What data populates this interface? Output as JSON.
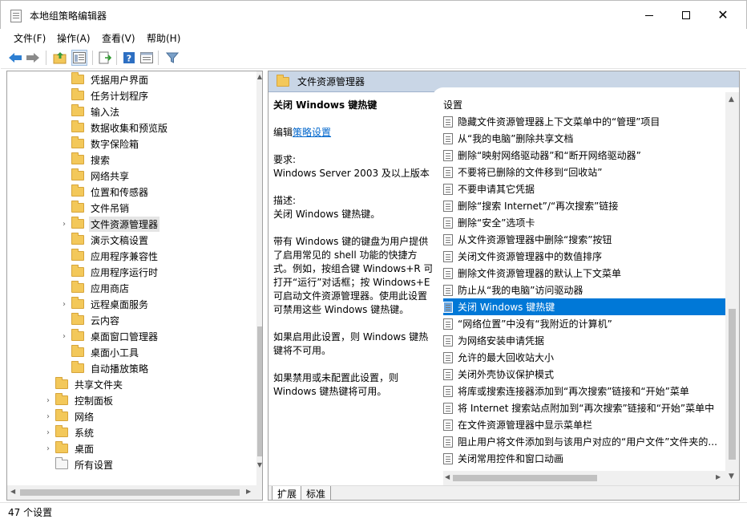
{
  "window": {
    "title": "本地组策略编辑器",
    "minimize": "—",
    "maximize": "□",
    "close": "✕"
  },
  "menu": {
    "items": [
      "文件(F)",
      "操作(A)",
      "查看(V)",
      "帮助(H)"
    ]
  },
  "toolbar": {
    "icons": [
      "back-arrow-icon",
      "forward-arrow-icon",
      "up-folder-icon",
      "show-hide-tree-icon",
      "export-list-icon",
      "help-icon",
      "properties-icon",
      "filter-icon"
    ]
  },
  "tree": {
    "items": [
      {
        "label": "凭据用户界面",
        "expandable": false,
        "indent": 2
      },
      {
        "label": "任务计划程序",
        "expandable": false,
        "indent": 2
      },
      {
        "label": "输入法",
        "expandable": false,
        "indent": 2
      },
      {
        "label": "数据收集和预览版",
        "expandable": false,
        "indent": 2
      },
      {
        "label": "数字保险箱",
        "expandable": false,
        "indent": 2
      },
      {
        "label": "搜索",
        "expandable": false,
        "indent": 2
      },
      {
        "label": "网络共享",
        "expandable": false,
        "indent": 2
      },
      {
        "label": "位置和传感器",
        "expandable": false,
        "indent": 2
      },
      {
        "label": "文件吊销",
        "expandable": false,
        "indent": 2
      },
      {
        "label": "文件资源管理器",
        "expandable": true,
        "indent": 2,
        "selected": true
      },
      {
        "label": "演示文稿设置",
        "expandable": false,
        "indent": 2
      },
      {
        "label": "应用程序兼容性",
        "expandable": false,
        "indent": 2
      },
      {
        "label": "应用程序运行时",
        "expandable": false,
        "indent": 2
      },
      {
        "label": "应用商店",
        "expandable": false,
        "indent": 2
      },
      {
        "label": "远程桌面服务",
        "expandable": true,
        "indent": 2
      },
      {
        "label": "云内容",
        "expandable": false,
        "indent": 2
      },
      {
        "label": "桌面窗口管理器",
        "expandable": true,
        "indent": 2
      },
      {
        "label": "桌面小工具",
        "expandable": false,
        "indent": 2
      },
      {
        "label": "自动播放策略",
        "expandable": false,
        "indent": 2
      },
      {
        "label": "共享文件夹",
        "expandable": false,
        "indent": 1
      },
      {
        "label": "控制面板",
        "expandable": true,
        "indent": 1
      },
      {
        "label": "网络",
        "expandable": true,
        "indent": 1
      },
      {
        "label": "系统",
        "expandable": true,
        "indent": 1
      },
      {
        "label": "桌面",
        "expandable": true,
        "indent": 1
      },
      {
        "label": "所有设置",
        "expandable": false,
        "indent": 1,
        "special": true
      }
    ]
  },
  "right": {
    "header": "文件资源管理器",
    "description": {
      "title": "关闭 Windows 键热键",
      "edit_prefix": "编辑",
      "edit_link": "策略设置",
      "requirements_label": "要求:",
      "requirements": "Windows Server 2003 及以上版本",
      "desc_label": "描述:",
      "desc": "关闭 Windows 键热键。",
      "details": "带有 Windows 键的键盘为用户提供了启用常见的 shell 功能的快捷方式。例如，按组合键 Windows+R 可打开“运行”对话框；按 Windows+E 可启动文件资源管理器。使用此设置可禁用这些 Windows 键热键。",
      "enabled": "如果启用此设置，则 Windows 键热键将不可用。",
      "disabled": "如果禁用或未配置此设置，则 Windows 键热键将可用。"
    },
    "settings_header": "设置",
    "settings": [
      "隐藏文件资源管理器上下文菜单中的“管理”项目",
      "从“我的电脑”删除共享文档",
      "删除“映射网络驱动器”和“断开网络驱动器”",
      "不要将已删除的文件移到“回收站”",
      "不要申请其它凭据",
      "删除“搜索 Internet”/“再次搜索”链接",
      "删除“安全”选项卡",
      "从文件资源管理器中删除“搜索”按钮",
      "关闭文件资源管理器中的数值排序",
      "删除文件资源管理器的默认上下文菜单",
      "防止从“我的电脑”访问驱动器",
      "关闭 Windows 键热键",
      "“网络位置”中没有“我附近的计算机”",
      "为网络安装申请凭据",
      "允许的最大回收站大小",
      "关闭外壳协议保护模式",
      "将库或搜索连接器添加到“再次搜索”链接和“开始”菜单",
      "将 Internet 搜索站点附加到“再次搜索”链接和“开始”菜单中",
      "在文件资源管理器中显示菜单栏",
      "阻止用户将文件添加到与该用户对应的“用户文件”文件夹的...",
      "关闭常用控件和窗口动画"
    ],
    "selected_index": 11,
    "tabs": [
      "扩展",
      "标准"
    ]
  },
  "status": {
    "text": "47 个设置"
  },
  "colors": {
    "selection": "#0078d7",
    "header_bg": "#c9d6e6",
    "folder": "#f3c85a"
  }
}
